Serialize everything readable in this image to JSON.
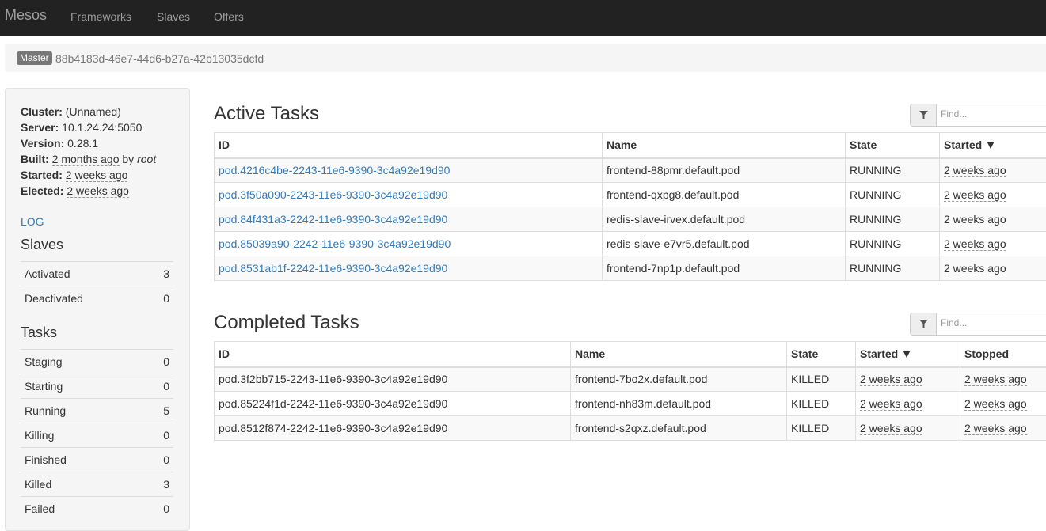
{
  "nav": {
    "brand": "Mesos",
    "links": [
      "Frameworks",
      "Slaves",
      "Offers"
    ]
  },
  "breadcrumb": {
    "badge": "Master",
    "master_id": "88b4183d-46e7-44d6-b27a-42b13035dcfd"
  },
  "sidebar": {
    "cluster_label": "Cluster:",
    "cluster_value": "(Unnamed)",
    "server_label": "Server:",
    "server_value": "10.1.24.24:5050",
    "version_label": "Version:",
    "version_value": "0.28.1",
    "built_label": "Built:",
    "built_ago": "2 months ago",
    "built_by": "by",
    "built_user": "root",
    "started_label": "Started:",
    "started_value": "2 weeks ago",
    "elected_label": "Elected:",
    "elected_value": "2 weeks ago",
    "log_link": "LOG",
    "slaves_heading": "Slaves",
    "slaves": [
      {
        "label": "Activated",
        "value": "3"
      },
      {
        "label": "Deactivated",
        "value": "0"
      }
    ],
    "tasks_heading": "Tasks",
    "tasks": [
      {
        "label": "Staging",
        "value": "0"
      },
      {
        "label": "Starting",
        "value": "0"
      },
      {
        "label": "Running",
        "value": "5"
      },
      {
        "label": "Killing",
        "value": "0"
      },
      {
        "label": "Finished",
        "value": "0"
      },
      {
        "label": "Killed",
        "value": "3"
      },
      {
        "label": "Failed",
        "value": "0"
      }
    ]
  },
  "active": {
    "title": "Active Tasks",
    "find_placeholder": "Find...",
    "headers": [
      "ID",
      "Name",
      "State",
      "Started ▼"
    ],
    "rows": [
      {
        "id": "pod.4216c4be-2243-11e6-9390-3c4a92e19d90",
        "name": "frontend-88pmr.default.pod",
        "state": "RUNNING",
        "started": "2 weeks ago"
      },
      {
        "id": "pod.3f50a090-2243-11e6-9390-3c4a92e19d90",
        "name": "frontend-qxpg8.default.pod",
        "state": "RUNNING",
        "started": "2 weeks ago"
      },
      {
        "id": "pod.84f431a3-2242-11e6-9390-3c4a92e19d90",
        "name": "redis-slave-irvex.default.pod",
        "state": "RUNNING",
        "started": "2 weeks ago"
      },
      {
        "id": "pod.85039a90-2242-11e6-9390-3c4a92e19d90",
        "name": "redis-slave-e7vr5.default.pod",
        "state": "RUNNING",
        "started": "2 weeks ago"
      },
      {
        "id": "pod.8531ab1f-2242-11e6-9390-3c4a92e19d90",
        "name": "frontend-7np1p.default.pod",
        "state": "RUNNING",
        "started": "2 weeks ago"
      }
    ]
  },
  "completed": {
    "title": "Completed Tasks",
    "find_placeholder": "Find...",
    "headers": [
      "ID",
      "Name",
      "State",
      "Started ▼",
      "Stopped"
    ],
    "rows": [
      {
        "id": "pod.3f2bb715-2243-11e6-9390-3c4a92e19d90",
        "name": "frontend-7bo2x.default.pod",
        "state": "KILLED",
        "started": "2 weeks ago",
        "stopped": "2 weeks ago"
      },
      {
        "id": "pod.85224f1d-2242-11e6-9390-3c4a92e19d90",
        "name": "frontend-nh83m.default.pod",
        "state": "KILLED",
        "started": "2 weeks ago",
        "stopped": "2 weeks ago"
      },
      {
        "id": "pod.8512f874-2242-11e6-9390-3c4a92e19d90",
        "name": "frontend-s2qxz.default.pod",
        "state": "KILLED",
        "started": "2 weeks ago",
        "stopped": "2 weeks ago"
      }
    ]
  }
}
